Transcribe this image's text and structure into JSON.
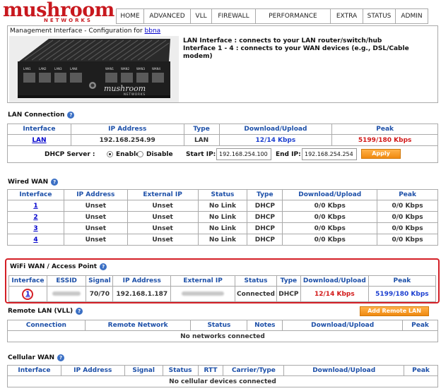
{
  "logo": {
    "word": "mushroom",
    "sub": "NETWORKS"
  },
  "nav": [
    "HOME",
    "ADVANCED",
    "VLL",
    "FIREWALL",
    "PERFORMANCE",
    "EXTRA",
    "STATUS",
    "ADMIN"
  ],
  "mgmt": {
    "title": "Management Interface - Configuration for ",
    "device": "bbna",
    "line1": "LAN Interface : connects to your LAN router/switch/hub",
    "line2": "Interface 1 - 4 : connects to your WAN devices (e.g., DSL/Cable modem)",
    "device_brand": "mushroom",
    "device_brand_sub": "NETWORKS",
    "port_labels": [
      "LAN1",
      "LAN2",
      "LAN3",
      "LAN4",
      "WAN1",
      "WAN2",
      "WAN3",
      "WAN4"
    ]
  },
  "lan": {
    "title": "LAN Connection",
    "headers": [
      "Interface",
      "IP Address",
      "Type",
      "Download/Upload",
      "Peak"
    ],
    "row": {
      "interface": "LAN",
      "ip": "192.168.254.99",
      "type": "LAN",
      "dl": "12/14 Kbps",
      "peak": "5199/180 Kbps"
    },
    "dhcp_label": "DHCP Server :",
    "enable": "Enable",
    "disable": "Disable",
    "start_label": "Start IP:",
    "start_ip": "192.168.254.100",
    "end_label": "End IP:",
    "end_ip": "192.168.254.254",
    "apply": "Apply"
  },
  "wired": {
    "title": "Wired WAN",
    "headers": [
      "Interface",
      "IP Address",
      "External IP",
      "Status",
      "Type",
      "Download/Upload",
      "Peak"
    ],
    "rows": [
      {
        "iface": "1",
        "ip": "Unset",
        "ext": "Unset",
        "status": "No Link",
        "type": "DHCP",
        "dl": "0/0 Kbps",
        "peak": "0/0 Kbps"
      },
      {
        "iface": "2",
        "ip": "Unset",
        "ext": "Unset",
        "status": "No Link",
        "type": "DHCP",
        "dl": "0/0 Kbps",
        "peak": "0/0 Kbps"
      },
      {
        "iface": "3",
        "ip": "Unset",
        "ext": "Unset",
        "status": "No Link",
        "type": "DHCP",
        "dl": "0/0 Kbps",
        "peak": "0/0 Kbps"
      },
      {
        "iface": "4",
        "ip": "Unset",
        "ext": "Unset",
        "status": "No Link",
        "type": "DHCP",
        "dl": "0/0 Kbps",
        "peak": "0/0 Kbps"
      }
    ]
  },
  "wifi": {
    "title": "WiFi WAN / Access Point",
    "headers": [
      "Interface",
      "ESSID",
      "Signal",
      "IP Address",
      "External IP",
      "Status",
      "Type",
      "Download/Upload",
      "Peak"
    ],
    "row": {
      "iface": "1",
      "signal": "70/70",
      "ip": "192.168.1.187",
      "status": "Connected",
      "type": "DHCP",
      "dl": "12/14 Kbps",
      "peak": "5199/180 Kbps"
    }
  },
  "remote": {
    "title": "Remote LAN (VLL)",
    "add": "Add Remote LAN",
    "headers": [
      "Connection",
      "Remote Network",
      "Status",
      "Notes",
      "Download/Upload",
      "Peak"
    ],
    "empty": "No networks connected"
  },
  "cellular": {
    "title": "Cellular WAN",
    "headers": [
      "Interface",
      "IP Address",
      "Signal",
      "Status",
      "RTT",
      "Carrier/Type",
      "Download/Upload",
      "Peak"
    ],
    "empty": "No cellular devices connected"
  },
  "colors": {
    "brand": "#c8181e",
    "header_blue": "#1c4fa8",
    "accent_orange": "#f08a10",
    "highlight_red": "#d41f26"
  }
}
